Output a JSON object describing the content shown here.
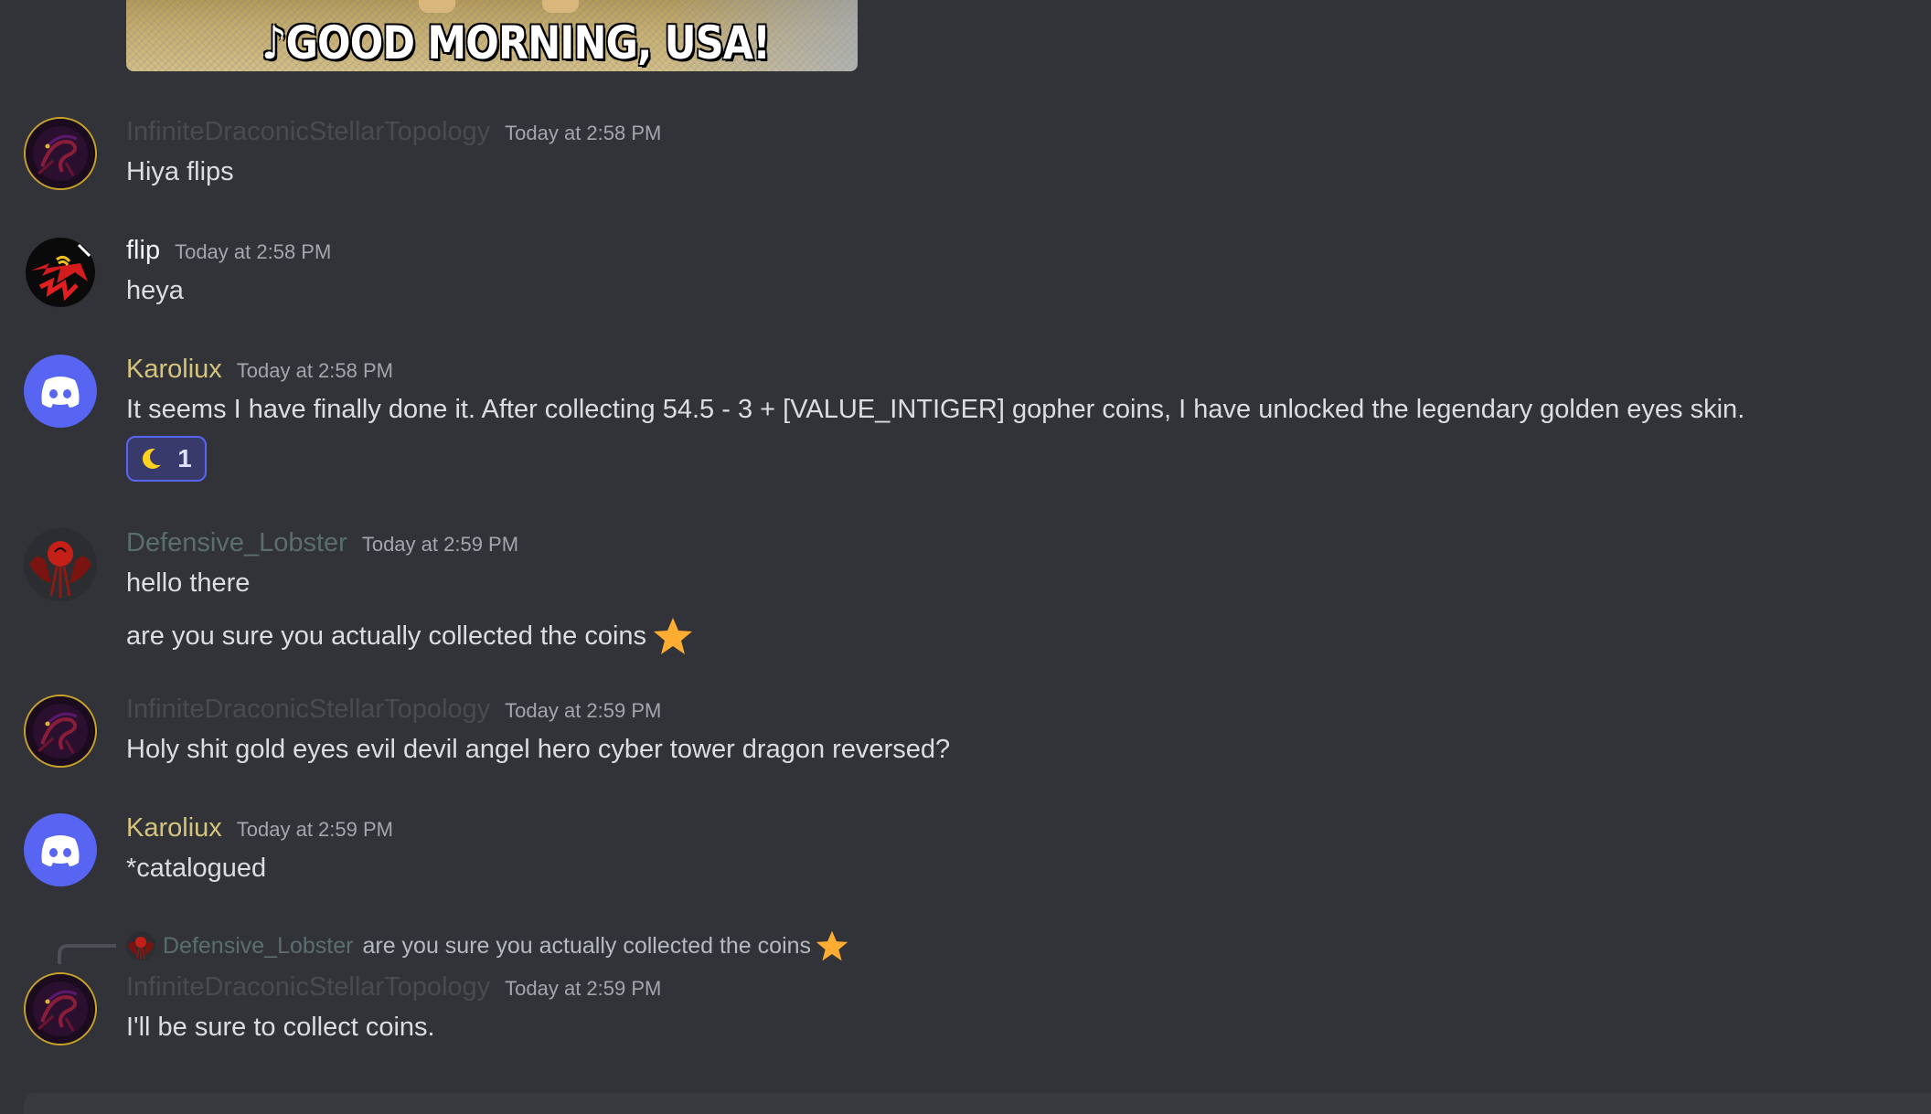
{
  "gif": {
    "caption": "♪GOOD MORNING, USA!"
  },
  "colors": {
    "background": "#313338",
    "username_faded": "#4b4b4f",
    "username_white": "#f2f3f5",
    "username_gold": "#d5c47c",
    "username_teal": "#5b6e6e",
    "timestamp": "#a3a6ac",
    "text": "#dbdee1",
    "blurple": "#5865f2"
  },
  "messages": [
    {
      "username": "InfiniteDraconicStellarTopology",
      "timestamp": "Today at 2:58 PM",
      "lines": [
        "Hiya flips"
      ]
    },
    {
      "username": "flip",
      "timestamp": "Today at 2:58 PM",
      "lines": [
        "heya"
      ]
    },
    {
      "username": "Karoliux",
      "timestamp": "Today at 2:58 PM",
      "lines": [
        "It seems I have finally done it. After collecting 54.5 - 3 + [VALUE_INTIGER] gopher coins, I have unlocked the legendary golden eyes skin."
      ],
      "reaction": {
        "emoji": "crescent-moon",
        "count": "1"
      }
    },
    {
      "username": "Defensive_Lobster",
      "timestamp": "Today at 2:59 PM",
      "lines": [
        "hello there",
        "are you sure you actually collected the coins"
      ],
      "emoji": "star"
    },
    {
      "username": "InfiniteDraconicStellarTopology",
      "timestamp": "Today at 2:59 PM",
      "lines": [
        "Holy shit gold eyes evil devil angel hero cyber tower dragon reversed?"
      ]
    },
    {
      "username": "Karoliux",
      "timestamp": "Today at 2:59 PM",
      "lines": [
        "*catalogued"
      ]
    },
    {
      "reply_to": {
        "username": "Defensive_Lobster",
        "text": "are you sure you actually collected the coins"
      },
      "username": "InfiniteDraconicStellarTopology",
      "timestamp": "Today at 2:59 PM",
      "lines": [
        "I'll be sure to collect coins."
      ]
    }
  ]
}
